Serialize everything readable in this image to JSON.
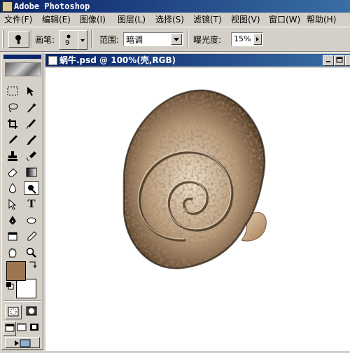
{
  "app": {
    "title": "Adobe Photoshop",
    "icon": "photoshop-eye-icon"
  },
  "menubar": {
    "items": [
      {
        "label": "文件(F)"
      },
      {
        "label": "编辑(E)"
      },
      {
        "label": "图像(I)"
      },
      {
        "label": "图层(L)"
      },
      {
        "label": "选择(S)"
      },
      {
        "label": "滤镜(T)"
      },
      {
        "label": "视图(V)"
      },
      {
        "label": "窗口(W)"
      },
      {
        "label": "帮助(H)"
      }
    ]
  },
  "options": {
    "brush_label": "画笔:",
    "brush_size": "9",
    "range_label": "范围:",
    "range_value": "暗调",
    "exposure_label": "曝光度:",
    "exposure_value": "15%"
  },
  "document": {
    "title": "蜗牛.psd @ 100%(壳,RGB)"
  },
  "colors": {
    "foreground": "#9b7650",
    "background": "#ffffff",
    "title_bar": "#0a246a",
    "chrome": "#d4d0c8"
  },
  "toolbox": {
    "tools": [
      "marquee-icon",
      "move-icon",
      "lasso-icon",
      "magic-wand-icon",
      "crop-icon",
      "slice-icon",
      "healing-brush-icon",
      "brush-icon",
      "clone-stamp-icon",
      "history-brush-icon",
      "eraser-icon",
      "gradient-icon",
      "blur-icon",
      "burn-icon",
      "path-selection-icon",
      "type-icon",
      "pen-icon",
      "shape-icon",
      "notes-icon",
      "eyedropper-icon",
      "hand-icon",
      "zoom-icon"
    ]
  }
}
